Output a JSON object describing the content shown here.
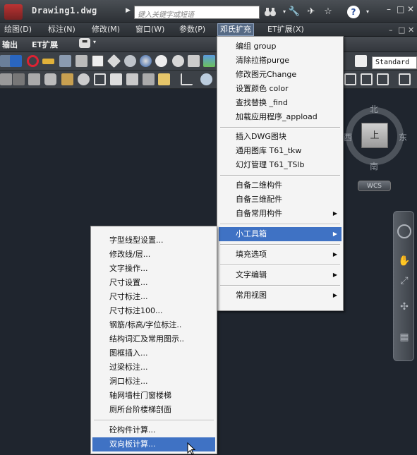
{
  "titlebar": {
    "title": "Drawing1.dwg",
    "search_placeholder": "键入关键字或短语",
    "icons": [
      "binoculars-icon",
      "wrench-icon",
      "satellite-icon",
      "star-icon",
      "help-icon"
    ],
    "minimize": "–",
    "restore": "□",
    "close": "✕",
    "help_glyph": "?"
  },
  "menubar": {
    "items": [
      "绘图(D)",
      "标注(N)",
      "修改(M)",
      "窗口(W)",
      "参数(P)",
      "邓氏扩充",
      "ET扩展(X)"
    ],
    "active_index": 5,
    "mdi_controls": [
      "–",
      "□",
      "✕"
    ]
  },
  "ribbon": {
    "tabs": [
      "输出",
      "ET扩展"
    ]
  },
  "toolbar": {
    "style_field": "Standard"
  },
  "viewcube": {
    "top": "上",
    "north": "北",
    "south": "南",
    "east": "东",
    "west": "西",
    "wcs": "WCS"
  },
  "main_menu": {
    "groups": [
      [
        "编组 group",
        "清除拉搭purge",
        "修改图元Change",
        "设置颜色 color",
        "查找替换 _find",
        "加载应用程序_appload"
      ],
      [
        "插入DWG图块",
        "通用图库 T61_tkw",
        "幻灯管理 T61_TSlb"
      ],
      [
        "自备二维构件",
        "自备三维配件",
        "自备常用构件"
      ],
      [
        "小工具箱"
      ],
      [
        "填充选项"
      ],
      [
        "文字编辑"
      ],
      [
        "常用视图"
      ]
    ],
    "submenu_items": [
      "自备常用构件",
      "小工具箱",
      "填充选项",
      "文字编辑",
      "常用视图"
    ],
    "highlighted": "小工具箱"
  },
  "sub_menu": {
    "groups": [
      [
        "字型线型设置...",
        "修改线/层...",
        "文字操作...",
        "尺寸设置...",
        "尺寸标注...",
        "尺寸标注100...",
        "钢筋/标高/字位标注..",
        "结构词汇及常用图示..",
        "图框插入...",
        "过梁标注...",
        "洞口标注...",
        "轴网墙柱门窗楼梯",
        "厕所台阶楼梯剖面"
      ],
      [
        "砼构件计算...",
        "双向板计算..."
      ]
    ],
    "highlighted": "双向板计算..."
  }
}
